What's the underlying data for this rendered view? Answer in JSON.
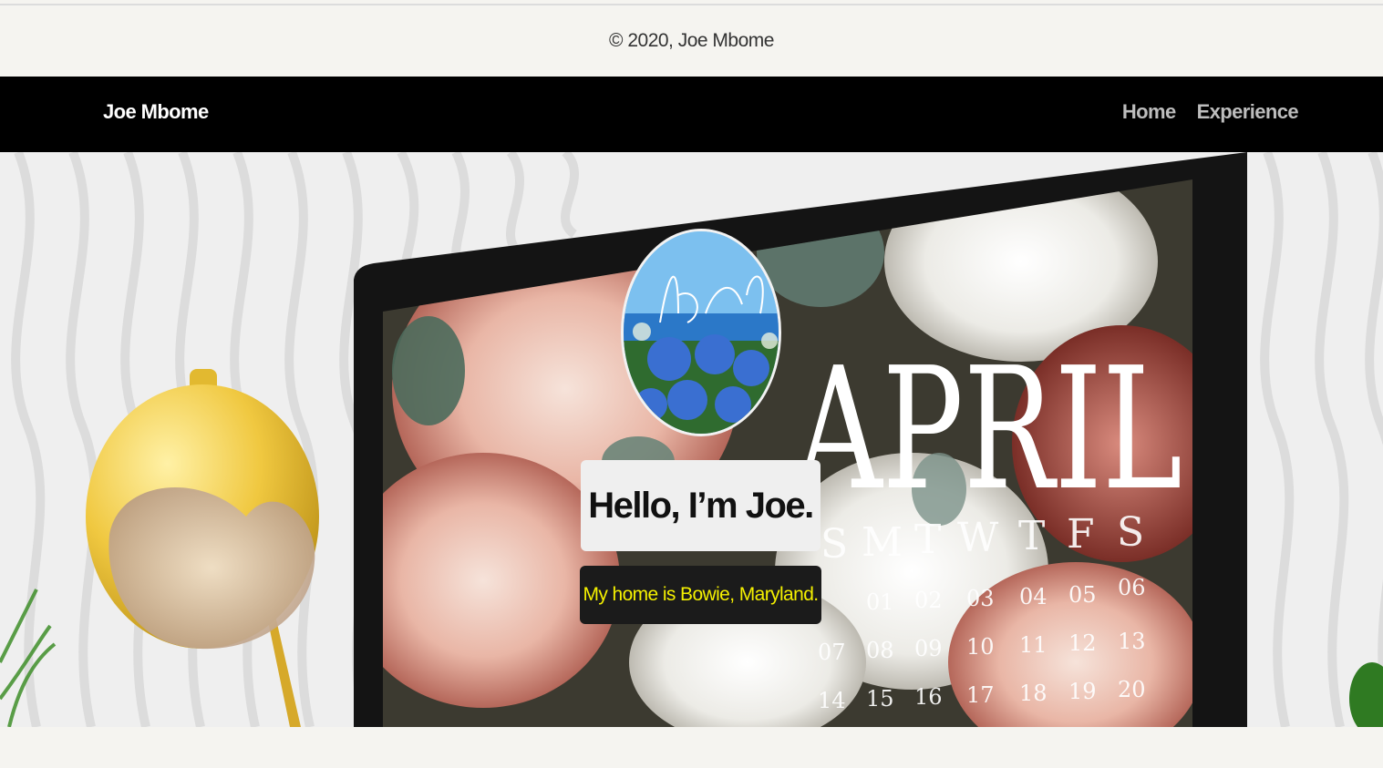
{
  "footer": {
    "copyright": "© 2020, Joe Mbome"
  },
  "navbar": {
    "brand": "Joe Mbome",
    "links": [
      {
        "label": "Home"
      },
      {
        "label": "Experience"
      }
    ]
  },
  "hero": {
    "greeting": "Hello, I’m Joe.",
    "location": "My home is Bowie, Maryland.",
    "calendar": {
      "month": "APRIL",
      "weekdays": [
        "S",
        "M",
        "T",
        "W",
        "T",
        "F",
        "S"
      ],
      "rows": [
        [
          "01",
          "02",
          "03",
          "04",
          "05",
          "06"
        ],
        [
          "07",
          "08",
          "09",
          "10",
          "11",
          "12",
          "13"
        ],
        [
          "14",
          "15",
          "16",
          "17",
          "18",
          "19",
          "20"
        ]
      ]
    }
  },
  "colors": {
    "navbar_bg": "#000000",
    "brand_text": "#ffffff",
    "nav_link": "#bdbdbd",
    "location_text": "#f4f000",
    "page_bg": "#f5f4f0"
  }
}
